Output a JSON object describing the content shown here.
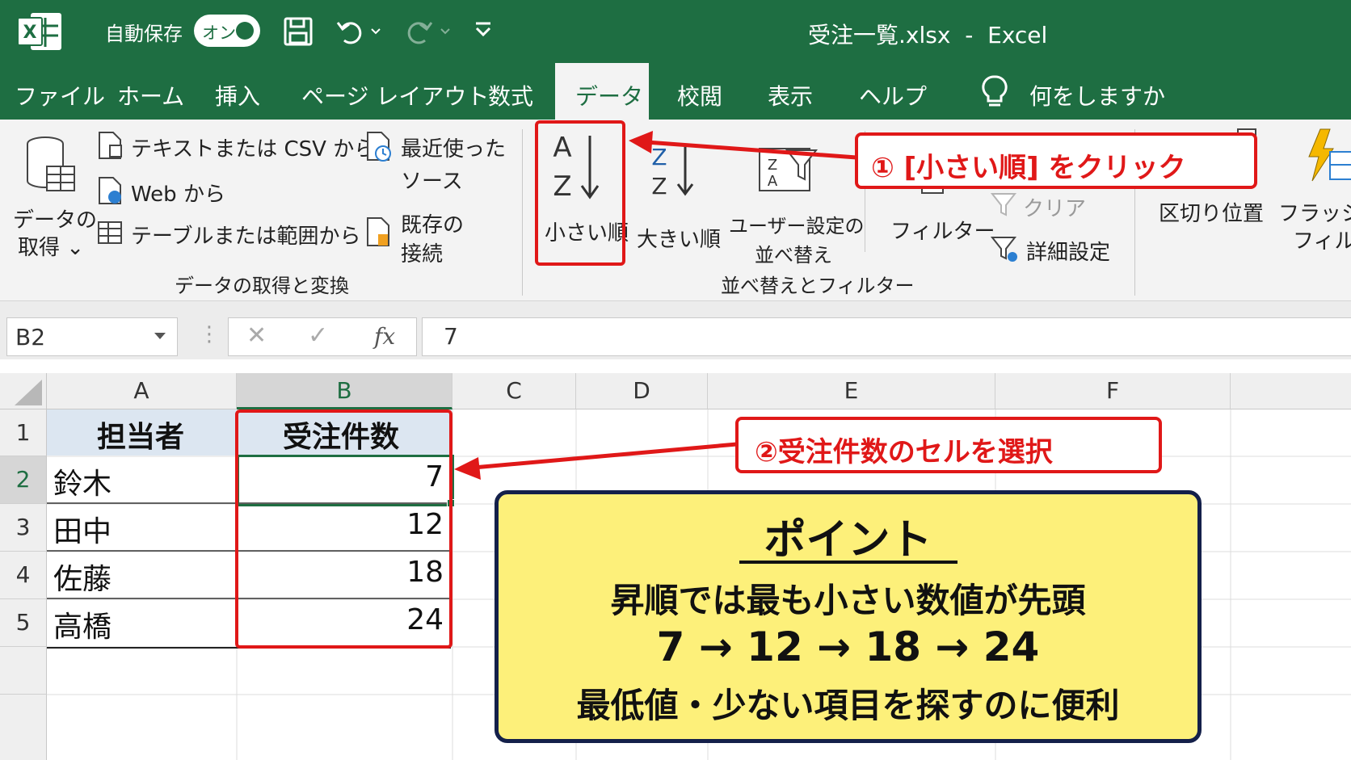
{
  "window": {
    "autosave_label": "自動保存",
    "autosave_toggle": "オン",
    "title": "受注一覧.xlsx  -  Excel"
  },
  "tabs": [
    "ファイル",
    "ホーム",
    "挿入",
    "ページ レイアウト",
    "数式",
    "データ",
    "校閲",
    "表示",
    "ヘルプ"
  ],
  "tellme": "何をしますか",
  "ribbon": {
    "get_data": [
      "データの",
      "取得 ⌄"
    ],
    "text_csv": "テキストまたは CSV から",
    "web": "Web から",
    "table_range": "テーブルまたは範囲から",
    "recent": [
      "最近使った",
      "ソース"
    ],
    "existing": [
      "既存の",
      "接続"
    ],
    "group1": "データの取得と変換",
    "sort_asc": "小さい順",
    "sort_desc": "大きい順",
    "custom_sort": [
      "ユーザー設定の",
      "並べ替え"
    ],
    "filter": "フィルター",
    "clear": "クリア",
    "advanced": "詳細設定",
    "group2": "並べ替えとフィルター",
    "split": "区切り位置",
    "flash": [
      "フラッシュ",
      "フィル"
    ]
  },
  "formula_bar": {
    "name_box": "B2",
    "fx": "fx",
    "value": "7"
  },
  "grid": {
    "columns": [
      "A",
      "B",
      "C",
      "D",
      "E",
      "F"
    ],
    "rows": [
      "1",
      "2",
      "3",
      "4",
      "5"
    ],
    "header": [
      "担当者",
      "受注件数"
    ],
    "data": [
      [
        "鈴木",
        "7"
      ],
      [
        "田中",
        "12"
      ],
      [
        "佐藤",
        "18"
      ],
      [
        "高橋",
        "24"
      ]
    ]
  },
  "callouts": {
    "step1": "① [小さい順] をクリック",
    "step2": "②受注件数のセルを選択"
  },
  "point": {
    "title": "ポイント",
    "line1": "昇順では最も小さい数値が先頭",
    "line2": "7 → 12 → 18 → 24",
    "line3": "最低値・少ない項目を探すのに便利"
  },
  "colors": {
    "excel_green": "#1e6e42",
    "accent_red": "#e01818",
    "point_bg": "#fdf07a"
  }
}
